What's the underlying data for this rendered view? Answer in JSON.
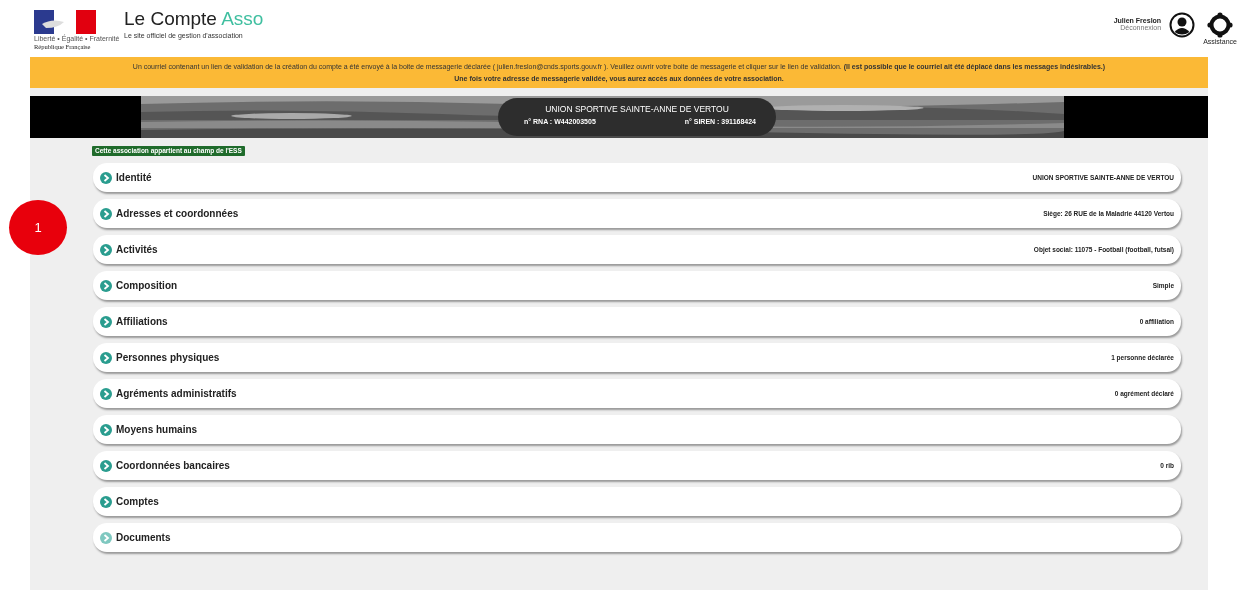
{
  "header": {
    "logo": {
      "motto": "Liberté • Égalité • Fraternité",
      "republic": "République Française"
    },
    "site_name": "Le Compte",
    "site_name_accent": "Asso",
    "tagline": "Le site officiel de gestion d'association",
    "user": {
      "name": "Julien Freslon",
      "logout": "Déconnexion"
    },
    "help": "Assistance"
  },
  "notice": {
    "lines": [
      "Un courriel contenant un lien de validation de la création du compte a été envoyé à la boite de messagerie déclarée ( julien.freslon@cnds.sports.gouv.fr ). Veuillez ouvrir votre boite de messagerie et cliquer sur le lien de validation. **(Il est possible que le courriel ait été déplacé dans les messages indésirables.)**",
      "**Une fois votre adresse de messagerie validée, vous aurez accès aux données de votre association.**"
    ]
  },
  "banner": {
    "name": "UNION SPORTIVE SAINTE-ANNE DE VERTOU",
    "rna": "n° RNA : W442003505",
    "siren": "n° SIREN : 391168424"
  },
  "ess_badge": "Cette association appartient au champ de l'ESS",
  "annotation": "1",
  "sections": [
    {
      "title": "Identité",
      "summary": "UNION SPORTIVE SAINTE-ANNE DE VERTOU",
      "disabled": false
    },
    {
      "title": "Adresses et coordonnées",
      "summary": "Siège: 26 RUE de la Maladrie 44120 Vertou",
      "disabled": false
    },
    {
      "title": "Activités",
      "summary": "Objet social: 11075 - Football (football, futsal)",
      "disabled": false
    },
    {
      "title": "Composition",
      "summary": "Simple",
      "disabled": false
    },
    {
      "title": "Affiliations",
      "summary": "0 affiliation",
      "disabled": false
    },
    {
      "title": "Personnes physiques",
      "summary": "1 personne déclarée",
      "disabled": false
    },
    {
      "title": "Agréments administratifs",
      "summary": "0 agrément déclaré",
      "disabled": false
    },
    {
      "title": "Moyens humains",
      "disabled": false
    },
    {
      "title": "Coordonnées bancaires",
      "summary": "0 rib",
      "disabled": false
    },
    {
      "title": "Comptes",
      "disabled": false
    },
    {
      "title": "Documents",
      "disabled": true
    }
  ]
}
